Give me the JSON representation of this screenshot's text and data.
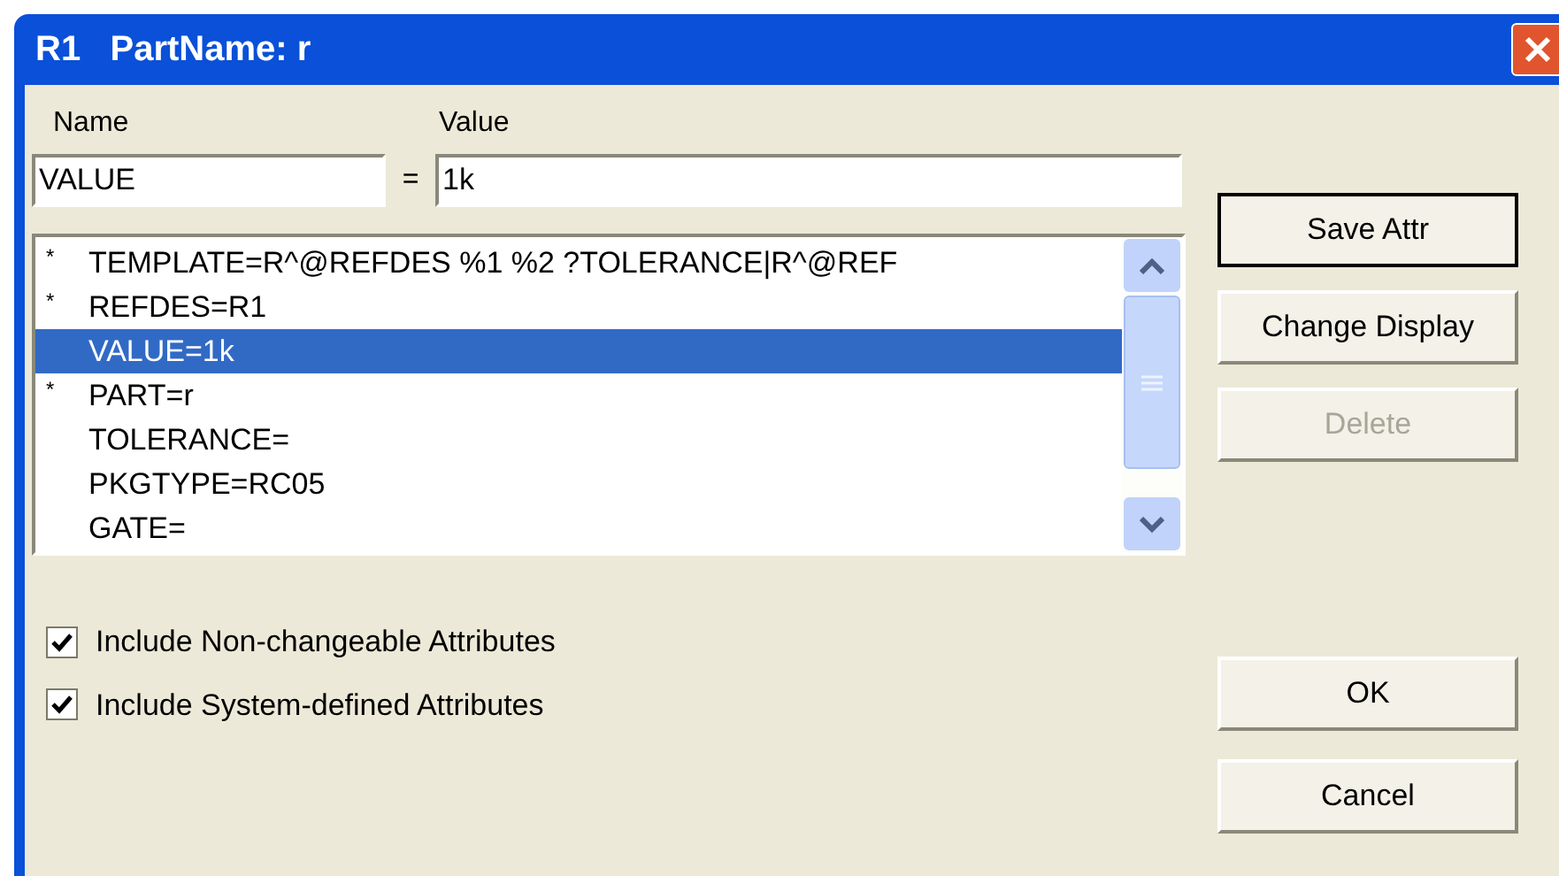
{
  "window": {
    "title": "R1   PartName: r"
  },
  "name_field": {
    "label": "Name",
    "value": "VALUE"
  },
  "equals": "=",
  "value_field": {
    "label": "Value",
    "value": "1k"
  },
  "attributes": [
    {
      "marker": "*",
      "text": "TEMPLATE=R^@REFDES %1 %2 ?TOLERANCE|R^@REF",
      "selected": false
    },
    {
      "marker": "*",
      "text": "REFDES=R1",
      "selected": false
    },
    {
      "text": "VALUE=1k",
      "selected": true
    },
    {
      "marker": "*",
      "text": "PART=r",
      "selected": false
    },
    {
      "text": "TOLERANCE=",
      "selected": false
    },
    {
      "text": "PKGTYPE=RC05",
      "selected": false
    },
    {
      "text": "GATE=",
      "selected": false
    }
  ],
  "side_buttons": [
    {
      "label": "Save Attr",
      "default": true,
      "disabled": false
    },
    {
      "label": "Change Display",
      "default": false,
      "disabled": false
    },
    {
      "label": "Delete",
      "default": false,
      "disabled": true
    }
  ],
  "options": [
    {
      "label": "Include Non-changeable Attributes",
      "checked": true
    },
    {
      "label": "Include System-defined Attributes",
      "checked": true
    }
  ],
  "dialog_buttons": [
    "OK",
    "Cancel"
  ]
}
